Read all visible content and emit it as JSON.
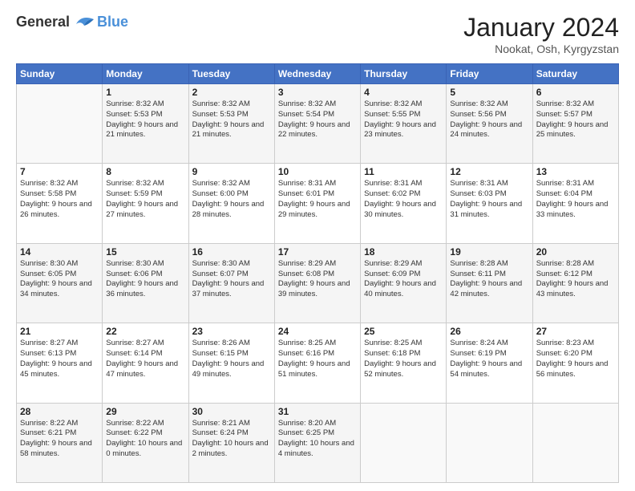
{
  "header": {
    "title": "January 2024",
    "location": "Nookat, Osh, Kyrgyzstan"
  },
  "days": [
    "Sunday",
    "Monday",
    "Tuesday",
    "Wednesday",
    "Thursday",
    "Friday",
    "Saturday"
  ],
  "weeks": [
    [
      {
        "day": "",
        "sunrise": "",
        "sunset": "",
        "daylight": ""
      },
      {
        "day": "1",
        "sunrise": "Sunrise: 8:32 AM",
        "sunset": "Sunset: 5:53 PM",
        "daylight": "Daylight: 9 hours and 21 minutes."
      },
      {
        "day": "2",
        "sunrise": "Sunrise: 8:32 AM",
        "sunset": "Sunset: 5:53 PM",
        "daylight": "Daylight: 9 hours and 21 minutes."
      },
      {
        "day": "3",
        "sunrise": "Sunrise: 8:32 AM",
        "sunset": "Sunset: 5:54 PM",
        "daylight": "Daylight: 9 hours and 22 minutes."
      },
      {
        "day": "4",
        "sunrise": "Sunrise: 8:32 AM",
        "sunset": "Sunset: 5:55 PM",
        "daylight": "Daylight: 9 hours and 23 minutes."
      },
      {
        "day": "5",
        "sunrise": "Sunrise: 8:32 AM",
        "sunset": "Sunset: 5:56 PM",
        "daylight": "Daylight: 9 hours and 24 minutes."
      },
      {
        "day": "6",
        "sunrise": "Sunrise: 8:32 AM",
        "sunset": "Sunset: 5:57 PM",
        "daylight": "Daylight: 9 hours and 25 minutes."
      }
    ],
    [
      {
        "day": "7",
        "sunrise": "Sunrise: 8:32 AM",
        "sunset": "Sunset: 5:58 PM",
        "daylight": "Daylight: 9 hours and 26 minutes."
      },
      {
        "day": "8",
        "sunrise": "Sunrise: 8:32 AM",
        "sunset": "Sunset: 5:59 PM",
        "daylight": "Daylight: 9 hours and 27 minutes."
      },
      {
        "day": "9",
        "sunrise": "Sunrise: 8:32 AM",
        "sunset": "Sunset: 6:00 PM",
        "daylight": "Daylight: 9 hours and 28 minutes."
      },
      {
        "day": "10",
        "sunrise": "Sunrise: 8:31 AM",
        "sunset": "Sunset: 6:01 PM",
        "daylight": "Daylight: 9 hours and 29 minutes."
      },
      {
        "day": "11",
        "sunrise": "Sunrise: 8:31 AM",
        "sunset": "Sunset: 6:02 PM",
        "daylight": "Daylight: 9 hours and 30 minutes."
      },
      {
        "day": "12",
        "sunrise": "Sunrise: 8:31 AM",
        "sunset": "Sunset: 6:03 PM",
        "daylight": "Daylight: 9 hours and 31 minutes."
      },
      {
        "day": "13",
        "sunrise": "Sunrise: 8:31 AM",
        "sunset": "Sunset: 6:04 PM",
        "daylight": "Daylight: 9 hours and 33 minutes."
      }
    ],
    [
      {
        "day": "14",
        "sunrise": "Sunrise: 8:30 AM",
        "sunset": "Sunset: 6:05 PM",
        "daylight": "Daylight: 9 hours and 34 minutes."
      },
      {
        "day": "15",
        "sunrise": "Sunrise: 8:30 AM",
        "sunset": "Sunset: 6:06 PM",
        "daylight": "Daylight: 9 hours and 36 minutes."
      },
      {
        "day": "16",
        "sunrise": "Sunrise: 8:30 AM",
        "sunset": "Sunset: 6:07 PM",
        "daylight": "Daylight: 9 hours and 37 minutes."
      },
      {
        "day": "17",
        "sunrise": "Sunrise: 8:29 AM",
        "sunset": "Sunset: 6:08 PM",
        "daylight": "Daylight: 9 hours and 39 minutes."
      },
      {
        "day": "18",
        "sunrise": "Sunrise: 8:29 AM",
        "sunset": "Sunset: 6:09 PM",
        "daylight": "Daylight: 9 hours and 40 minutes."
      },
      {
        "day": "19",
        "sunrise": "Sunrise: 8:28 AM",
        "sunset": "Sunset: 6:11 PM",
        "daylight": "Daylight: 9 hours and 42 minutes."
      },
      {
        "day": "20",
        "sunrise": "Sunrise: 8:28 AM",
        "sunset": "Sunset: 6:12 PM",
        "daylight": "Daylight: 9 hours and 43 minutes."
      }
    ],
    [
      {
        "day": "21",
        "sunrise": "Sunrise: 8:27 AM",
        "sunset": "Sunset: 6:13 PM",
        "daylight": "Daylight: 9 hours and 45 minutes."
      },
      {
        "day": "22",
        "sunrise": "Sunrise: 8:27 AM",
        "sunset": "Sunset: 6:14 PM",
        "daylight": "Daylight: 9 hours and 47 minutes."
      },
      {
        "day": "23",
        "sunrise": "Sunrise: 8:26 AM",
        "sunset": "Sunset: 6:15 PM",
        "daylight": "Daylight: 9 hours and 49 minutes."
      },
      {
        "day": "24",
        "sunrise": "Sunrise: 8:25 AM",
        "sunset": "Sunset: 6:16 PM",
        "daylight": "Daylight: 9 hours and 51 minutes."
      },
      {
        "day": "25",
        "sunrise": "Sunrise: 8:25 AM",
        "sunset": "Sunset: 6:18 PM",
        "daylight": "Daylight: 9 hours and 52 minutes."
      },
      {
        "day": "26",
        "sunrise": "Sunrise: 8:24 AM",
        "sunset": "Sunset: 6:19 PM",
        "daylight": "Daylight: 9 hours and 54 minutes."
      },
      {
        "day": "27",
        "sunrise": "Sunrise: 8:23 AM",
        "sunset": "Sunset: 6:20 PM",
        "daylight": "Daylight: 9 hours and 56 minutes."
      }
    ],
    [
      {
        "day": "28",
        "sunrise": "Sunrise: 8:22 AM",
        "sunset": "Sunset: 6:21 PM",
        "daylight": "Daylight: 9 hours and 58 minutes."
      },
      {
        "day": "29",
        "sunrise": "Sunrise: 8:22 AM",
        "sunset": "Sunset: 6:22 PM",
        "daylight": "Daylight: 10 hours and 0 minutes."
      },
      {
        "day": "30",
        "sunrise": "Sunrise: 8:21 AM",
        "sunset": "Sunset: 6:24 PM",
        "daylight": "Daylight: 10 hours and 2 minutes."
      },
      {
        "day": "31",
        "sunrise": "Sunrise: 8:20 AM",
        "sunset": "Sunset: 6:25 PM",
        "daylight": "Daylight: 10 hours and 4 minutes."
      },
      {
        "day": "",
        "sunrise": "",
        "sunset": "",
        "daylight": ""
      },
      {
        "day": "",
        "sunrise": "",
        "sunset": "",
        "daylight": ""
      },
      {
        "day": "",
        "sunrise": "",
        "sunset": "",
        "daylight": ""
      }
    ]
  ]
}
